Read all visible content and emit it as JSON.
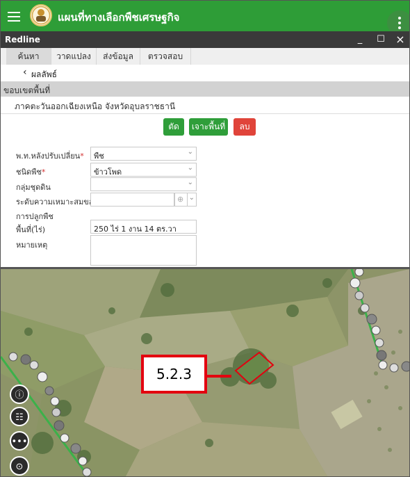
{
  "app": {
    "title": "แผนที่ทางเลือกพืชเศรษฐกิจ"
  },
  "window": {
    "title": "Redline",
    "minimize": "_",
    "maximize": "☐",
    "close": "×"
  },
  "tabs": [
    {
      "label": "ค้นหา",
      "active": true
    },
    {
      "label": "วาดแปลง",
      "active": false
    },
    {
      "label": "ส่งข้อมูล",
      "active": false
    },
    {
      "label": "ตรวจสอบพื้นที่",
      "active": false
    }
  ],
  "back": {
    "label": "ผลลัพธ์"
  },
  "section": {
    "title": "ขอบเขตพื้นที่"
  },
  "region": {
    "text": "ภาคตะวันออกเฉียงเหนือ จังหวัดอุบลราชธานี"
  },
  "actions": {
    "cut": "ตัด",
    "clip": "เจาะพื้นที่",
    "delete": "ลบ"
  },
  "form": {
    "crop_after": {
      "label": "พ.ท.หลังปรับเปลี่ยน",
      "required": "*",
      "value": "พืช"
    },
    "crop_type": {
      "label": "ชนิดพืช",
      "required": "*",
      "value": "ข้าวโพด"
    },
    "soil_group": {
      "label": "กลุ่มชุดดิน",
      "value": ""
    },
    "suitability": {
      "label_line1": "ระดับความเหมาะสมของ",
      "label_line2": "การปลูกพืช",
      "value": ""
    },
    "area": {
      "label": "พื้นที่(ไร่)",
      "value": "250 ไร่ 1 งาน 14 ตร.วา"
    },
    "note": {
      "label": "หมายเหตุ",
      "value": ""
    }
  },
  "map": {
    "callout": "5.2.3",
    "controls": [
      "info-icon",
      "layers-list-icon",
      "more-icon",
      "locate-icon"
    ]
  },
  "colors": {
    "header": "#2e9d37",
    "danger": "#e0443a",
    "callout": "#e3000f"
  }
}
